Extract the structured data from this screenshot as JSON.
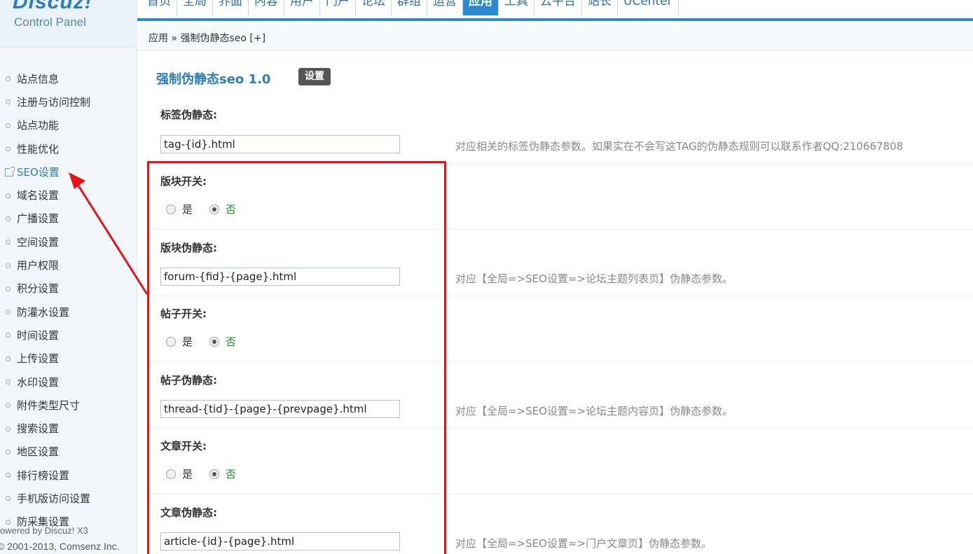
{
  "header": {
    "logo": "Discuz!",
    "logo_sub": "Control Panel",
    "nav": [
      "首页",
      "全局",
      "界面",
      "内容",
      "用户",
      "门户",
      "论坛",
      "群组",
      "运营",
      "应用",
      "工具",
      "云平台",
      "站长",
      "UCenter"
    ],
    "active_nav": "应用"
  },
  "breadcrumb": "应用 » 强制伪静态seo  [+]",
  "sidebar": {
    "items": [
      {
        "label": "站点信息"
      },
      {
        "label": "注册与访问控制"
      },
      {
        "label": "站点功能"
      },
      {
        "label": "性能优化"
      },
      {
        "label": "SEO设置"
      },
      {
        "label": "域名设置"
      },
      {
        "label": "广播设置"
      },
      {
        "label": "空间设置"
      },
      {
        "label": "用户权限"
      },
      {
        "label": "积分设置"
      },
      {
        "label": "防灌水设置"
      },
      {
        "label": "时间设置"
      },
      {
        "label": "上传设置"
      },
      {
        "label": "水印设置"
      },
      {
        "label": "附件类型尺寸"
      },
      {
        "label": "搜索设置"
      },
      {
        "label": "地区设置"
      },
      {
        "label": "排行榜设置"
      },
      {
        "label": "手机版访问设置"
      },
      {
        "label": "防采集设置"
      }
    ],
    "active_item": "SEO设置",
    "copyright_line1": "owered by Discuz! X3",
    "copyright_line2": "© 2001-2013, Comsenz Inc."
  },
  "main": {
    "plugin_title": "强制伪静态seo 1.0",
    "badge": "设置",
    "tag": {
      "label": "标签伪静态:",
      "value": "tag-{id}.html",
      "desc": "对应相关的标签伪静态参数。如果实在不会写这TAG的伪静态规则可以联系作者QQ:210667808"
    },
    "forum_switch": {
      "label": "版块开关:",
      "yes": "是",
      "no": "否",
      "selected": "否"
    },
    "forum": {
      "label": "版块伪静态:",
      "value": "forum-{fid}-{page}.html",
      "desc": "对应【全局=>SEO设置=>论坛主题列表页】伪静态参数。"
    },
    "thread_switch": {
      "label": "帖子开关:",
      "yes": "是",
      "no": "否",
      "selected": "否"
    },
    "thread": {
      "label": "帖子伪静态:",
      "value": "thread-{tid}-{page}-{prevpage}.html",
      "desc": "对应【全局=>SEO设置=>论坛主题内容页】伪静态参数。"
    },
    "article_switch": {
      "label": "文章开关:",
      "yes": "是",
      "no": "否",
      "selected": "否"
    },
    "article": {
      "label": "文章伪静态:",
      "value": "article-{id}-{page}.html",
      "desc": "对应【全局=>SEO设置=>门户文章页】伪静态参数。"
    }
  },
  "colors": {
    "accent": "#2d8ad0",
    "annotation": "#e5141a",
    "selected_radio_text": "#1a9a1a"
  }
}
